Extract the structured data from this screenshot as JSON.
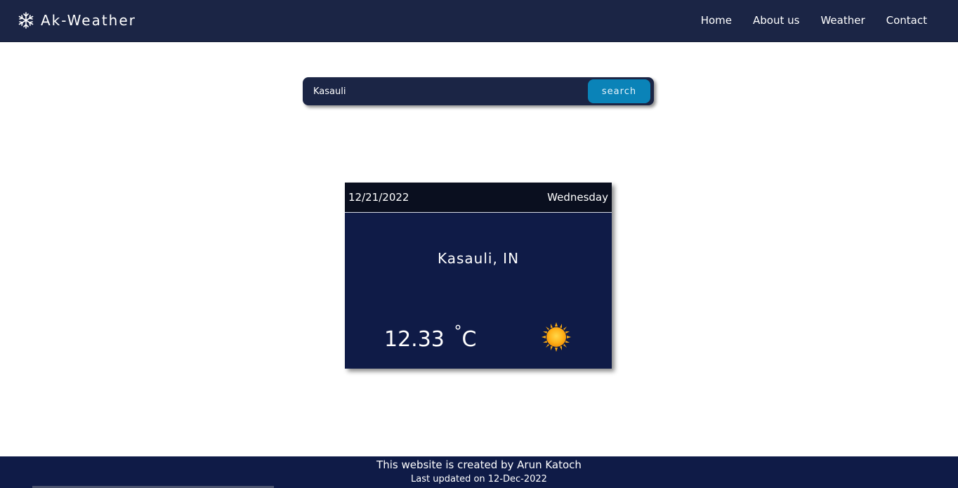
{
  "nav": {
    "brand": "Ak-Weather",
    "brand_icon": "snowflake-icon",
    "links": [
      "Home",
      "About us",
      "Weather",
      "Contact"
    ]
  },
  "search": {
    "value": "Kasauli",
    "button_label": "search"
  },
  "card": {
    "date": "12/21/2022",
    "day": "Wednesday",
    "location": "Kasauli, IN",
    "temperature": "12.33",
    "unit_degree": "°",
    "unit": "C",
    "condition_icon": "sun-icon"
  },
  "footer": {
    "credit": "This website is created by Arun Katoch",
    "updated": "Last updated on 12-Dec-2022"
  },
  "colors": {
    "navbar": "#1b2545",
    "search_button": "#0a83b8",
    "card_body": "#0f1b47",
    "card_header": "#0a0f1f",
    "footer": "#0f1b47"
  }
}
